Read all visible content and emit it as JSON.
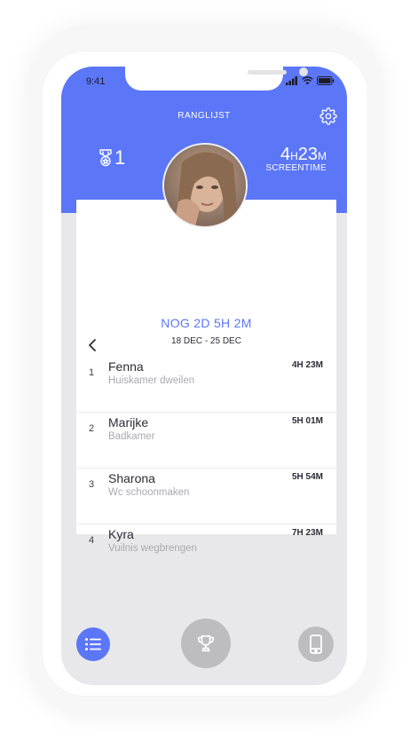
{
  "status_bar": {
    "time": "9:41"
  },
  "header": {
    "title": "RANGLIJST",
    "rank": "1",
    "screentime": {
      "hours": "4",
      "hours_unit": "H",
      "minutes": "23",
      "minutes_unit": "M",
      "label": "SCREENTIME"
    }
  },
  "leaderboard": {
    "countdown": "NOG 2D 5H 2M",
    "date_range": "18 DEC - 25 DEC",
    "rows": [
      {
        "rank": "1",
        "name": "Fenna",
        "task": "Huiskamer dweilen",
        "time": "4H 23M"
      },
      {
        "rank": "2",
        "name": "Marijke",
        "task": "Badkamer",
        "time": "5H 01M"
      },
      {
        "rank": "3",
        "name": "Sharona",
        "task": "Wc schoonmaken",
        "time": "5H 54M"
      },
      {
        "rank": "4",
        "name": "Kyra",
        "task": "Vuilnis wegbrengen",
        "time": "7H 23M"
      }
    ]
  },
  "nav": {
    "items": [
      "list-icon",
      "trophy-icon",
      "phone-icon"
    ]
  },
  "colors": {
    "accent": "#5b76f7",
    "inactive": "#bdbdc0",
    "background": "#e8e8ea"
  }
}
